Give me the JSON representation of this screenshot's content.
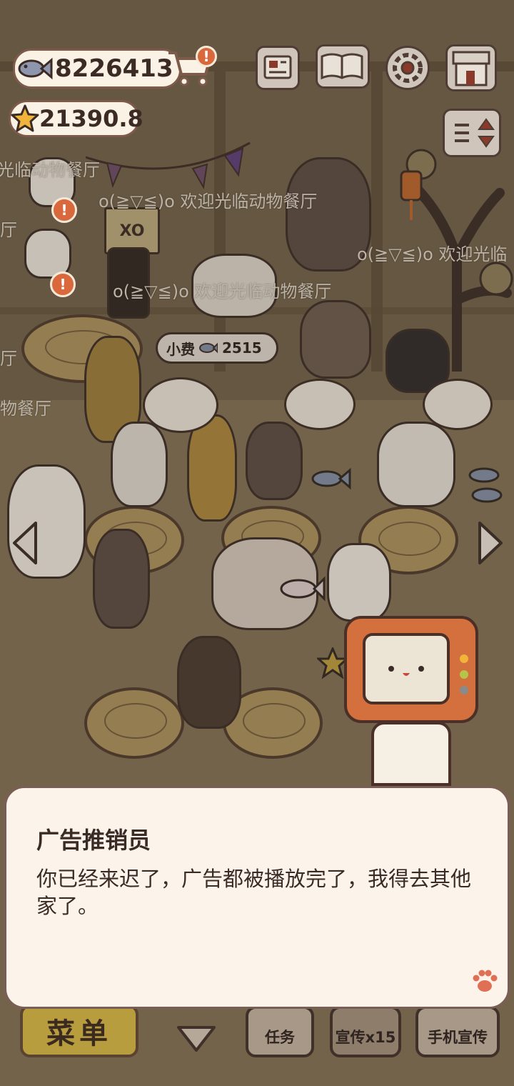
{
  "hud": {
    "fish_count": "8226413",
    "star_count": "21390.8",
    "alert_mark": "!"
  },
  "scene": {
    "welcome_texts": [
      "光临动物餐厅",
      "o(≧▽≦)o 欢迎光临动物餐厅",
      "o(≧▽≦)o 欢迎光临",
      "o(≧▽≦)o 欢迎光临动物餐厅",
      "厅",
      "物餐厅",
      "厅"
    ],
    "tip_label": "小费",
    "tip_amount": "2515",
    "sign_text": "XO"
  },
  "bottom_bar": {
    "menu_label": "菜单",
    "task_label": "任务",
    "promo_label": "宣传x15",
    "phone_promo_label": "手机宣传"
  },
  "dialog": {
    "speaker": "广告推销员",
    "message": "你已经来迟了，广告都被播放完了，我得去其他家了。"
  },
  "colors": {
    "accent": "#d3703e",
    "alert": "#d9683c",
    "dialog_bg": "#fcf3ea"
  }
}
